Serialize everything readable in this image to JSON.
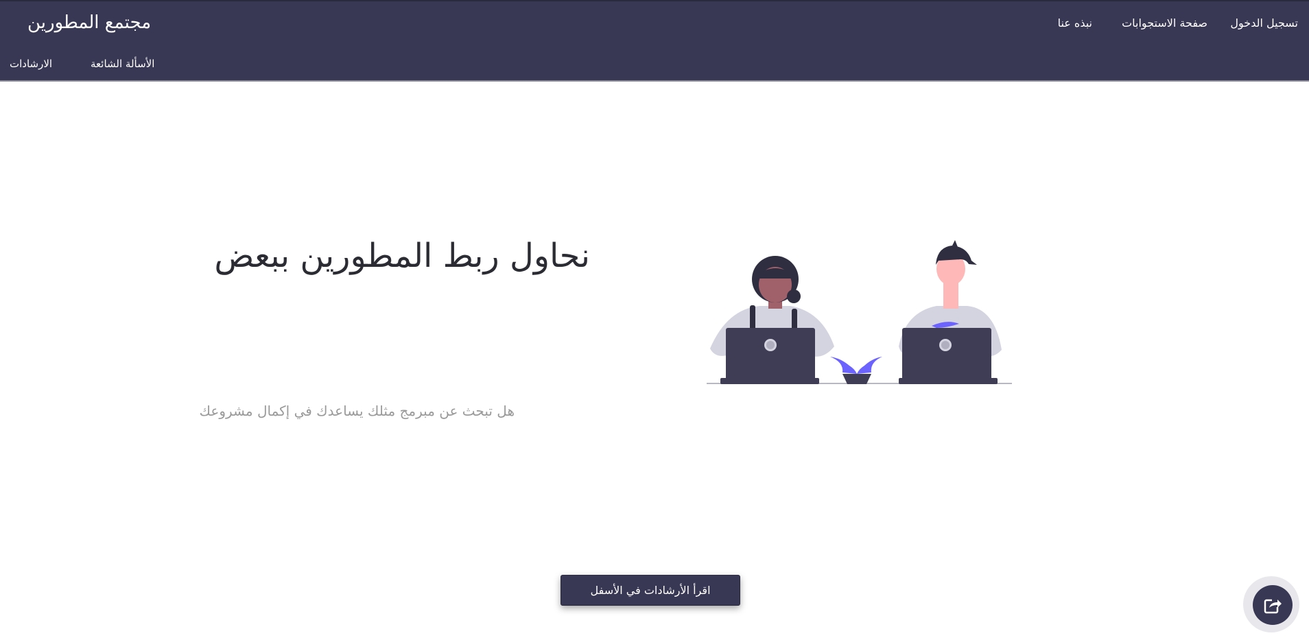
{
  "header": {
    "brand": "مجتمع المطورين",
    "nav_top": {
      "login": "تسجيل الدخول",
      "responses": "صفحة الاستجوابات",
      "about": "نبذه عنا"
    },
    "nav_bottom": {
      "faq": "الأسألة الشائعة",
      "guides": "الارشادات"
    }
  },
  "hero": {
    "headline": "نحاول ربط المطورين ببعض",
    "subline": "هل تبحث عن مبرمج مثلك يساعدك في إكمال مشروعك"
  },
  "cta": {
    "label": "اقرأ الأرشادات في الأسفل"
  },
  "floating_action": {
    "icon": "share-icon"
  },
  "colors": {
    "primary": "#383754",
    "accent": "#6c63ff",
    "text_muted": "#9a9a9a"
  }
}
